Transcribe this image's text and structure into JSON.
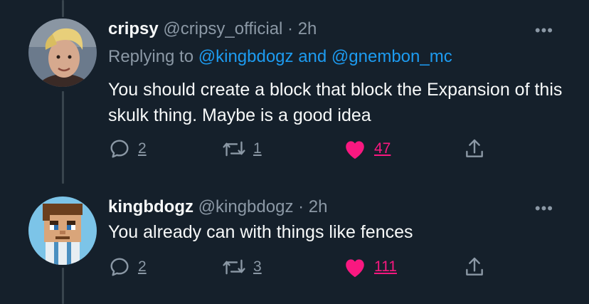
{
  "tweets": [
    {
      "name": "cripsy",
      "handle": "@cripsy_official",
      "time": "· 2h",
      "replying_prefix": "Replying to",
      "mention1": "@kingbdogz",
      "and": "and",
      "mention2": "@gnembon_mc",
      "text": "You should create a block that block the Expansion of this skulk thing. Maybe is a good idea",
      "replies": "2",
      "retweets": "1",
      "likes": "47"
    },
    {
      "name": "kingbdogz",
      "handle": "@kingbdogz",
      "time": "· 2h",
      "text": "You already can with things like fences",
      "replies": "2",
      "retweets": "3",
      "likes": "111"
    }
  ],
  "more_label": "•••",
  "colors": {
    "background": "#15202b",
    "accent": "#1d9bf0",
    "like": "#f91880",
    "muted": "#8b98a5"
  },
  "icons": [
    "reply-icon",
    "retweet-icon",
    "heart-icon",
    "share-icon",
    "more-icon"
  ]
}
